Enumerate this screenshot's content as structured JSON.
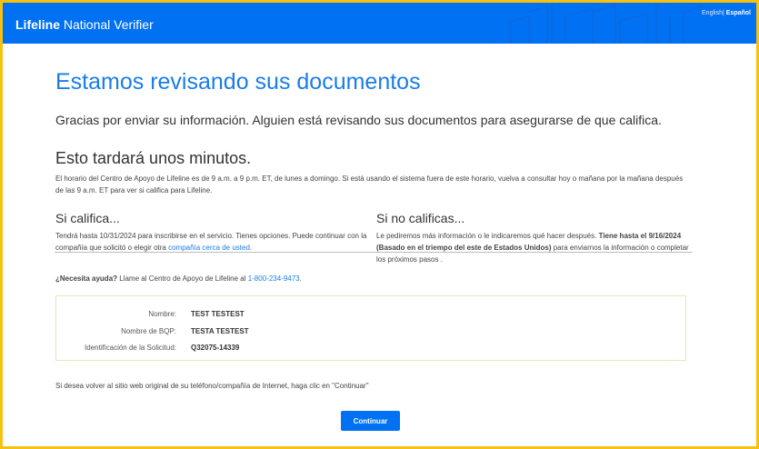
{
  "header": {
    "brand_bold": "Lifeline",
    "brand_rest": "National Verifier",
    "lang_english": "English",
    "lang_separator": "|",
    "lang_spanish": "Español",
    "color": "#0071f2"
  },
  "main": {
    "title": "Estamos revisando sus documentos",
    "subtitle": "Gracias por enviar su información. Alguien está revisando sus documentos para asegurarse de que califica.",
    "wait_heading": "Esto tardará unos minutos.",
    "hours_text": "El horario del Centro de Apoyo de Lifeline es de 9 a.m. a 9 p.m. ET, de lunes a domingo. Si está usando el sistema fuera de este horario, vuelva a consultar hoy o mañana por la mañana después de las 9 a.m. ET para ver si califica para Lifeline.",
    "qualify": {
      "heading": "Si califica...",
      "text_before": "Tendrá hasta 10/31/2024 para inscribirse en el servicio. Tienes opciones. Puede continuar con la compañía que solicitó o elegir otra ",
      "link": "compañía cerca de usted",
      "text_after": "."
    },
    "not_qualify": {
      "heading": "Si no calificas...",
      "text_before": "Le pediremos más información o le indicaremos qué hacer después. ",
      "bold": "Tiene hasta el 9/16/2024 (Basado en el triempo del este de Estados Unidos)",
      "text_after": " para enviarnos la información o completar los próximos pasos ."
    },
    "help": {
      "bold": "¿Necesita ayuda?",
      "text": " Llame al Centro de Apoyo de Lifeline al ",
      "phone": "1-800-234-9473",
      "end": "."
    },
    "details": [
      {
        "label": "Nombre:",
        "value": "TEST TESTEST"
      },
      {
        "label": "Nombre de BQP:",
        "value": "TESTA TESTEST"
      },
      {
        "label": "Identificación de la Solicitud:",
        "value": "Q32075-14339"
      }
    ],
    "return_text": "Si desea volver al sitio web original de su teléfono/compañía de Internet, haga clic en \"Continuar\"",
    "continue_label": "Continuar"
  }
}
